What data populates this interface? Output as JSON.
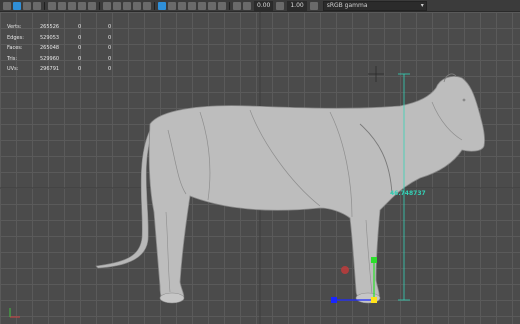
{
  "toolbar": {
    "value_a": "0.00",
    "value_b": "1.00",
    "color_space": "sRGB gamma"
  },
  "hud": {
    "rows": [
      {
        "label": "Verts:",
        "v": "265526",
        "c1": "0",
        "c2": "0"
      },
      {
        "label": "Edges:",
        "v": "529053",
        "c1": "0",
        "c2": "0"
      },
      {
        "label": "Faces:",
        "v": "265048",
        "c1": "0",
        "c2": "0"
      },
      {
        "label": "Tris:",
        "v": "529960",
        "c1": "0",
        "c2": "0"
      },
      {
        "label": "UVs:",
        "v": "296791",
        "c1": "0",
        "c2": "0"
      }
    ]
  },
  "measure": {
    "value": "46.748737"
  },
  "colors": {
    "measure": "#33d2b7",
    "manip_y": "#2be02b",
    "manip_x": "#1a26ff",
    "manip_center": "#ffe21a"
  }
}
